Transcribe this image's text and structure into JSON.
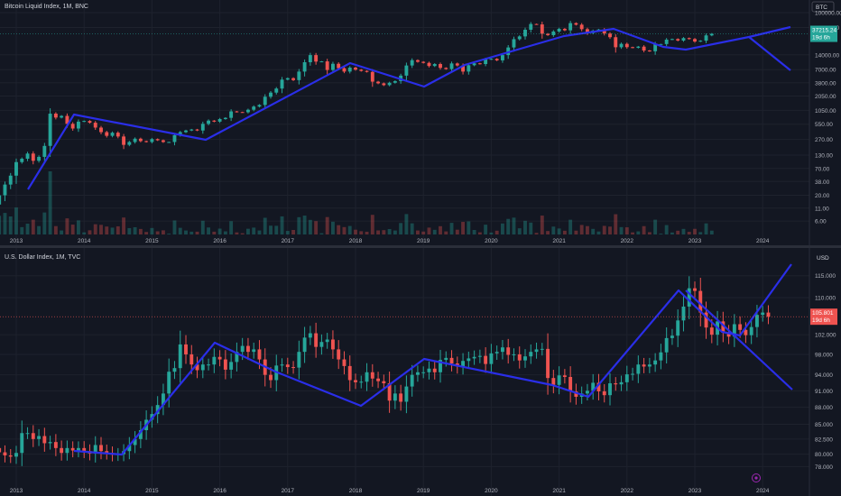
{
  "panes": [
    {
      "title": "Bitcoin Liquid Index, 1M, BNC",
      "currency": "BTC",
      "scale": "log",
      "y_ticks": [
        "100000.00",
        "50000.00",
        "14000.00",
        "7000.00",
        "3800.00",
        "2050.00",
        "1050.00",
        "550.00",
        "270.00",
        "130.00",
        "70.00",
        "38.00",
        "20.00",
        "11.00",
        "6.00"
      ],
      "y_range": [
        3.5,
        140000
      ],
      "last_price": "37215.24",
      "countdown": "19d 6h",
      "last_color": "#26a69a"
    },
    {
      "title": "U.S. Dollar Index, 1M, TVC",
      "currency": "USD",
      "scale": "log",
      "y_ticks": [
        "115.000",
        "110.000",
        "102.000",
        "98.000",
        "94.000",
        "91.000",
        "88.000",
        "85.000",
        "82.500",
        "80.000",
        "78.000"
      ],
      "y_range": [
        76.5,
        117.5
      ],
      "last_price": "105.801",
      "countdown": "19d 6h",
      "last_color": "#ef5350"
    }
  ],
  "x_axis": [
    "2013",
    "2014",
    "2015",
    "2016",
    "2017",
    "2018",
    "2019",
    "2020",
    "2021",
    "2022",
    "2023",
    "2024"
  ],
  "chart_data": [
    {
      "type": "candlestick",
      "title": "Bitcoin Liquid Index, 1M, BNC",
      "x_start": 2012.5,
      "y_scale": "log",
      "closes": [
        8,
        10,
        13,
        20,
        33,
        50,
        94,
        110,
        140,
        100,
        120,
        200,
        900,
        750,
        810,
        560,
        450,
        620,
        640,
        590,
        470,
        380,
        320,
        370,
        310,
        210,
        240,
        280,
        250,
        240,
        275,
        260,
        240,
        240,
        330,
        380,
        410,
        430,
        410,
        560,
        650,
        620,
        700,
        740,
        1000,
        970,
        960,
        1080,
        1250,
        1350,
        1980,
        2400,
        2900,
        4400,
        4700,
        4300,
        6400,
        9900,
        13800,
        10200,
        10300,
        6900,
        9200,
        7500,
        6400,
        7700,
        7000,
        6600,
        6300,
        4000,
        3700,
        3400,
        3800,
        4100,
        5300,
        8500,
        10900,
        10100,
        9600,
        8300,
        9100,
        7600,
        7200,
        9350,
        8500,
        6400,
        8600,
        9400,
        9100,
        11300,
        11600,
        10800,
        13800,
        19700,
        29000,
        33000,
        45000,
        58800,
        57700,
        37300,
        35000,
        41500,
        47000,
        43800,
        61300,
        57000,
        46200,
        38500,
        43200,
        45500,
        37700,
        31800,
        19900,
        23300,
        20000,
        19400,
        20500,
        17100,
        16500,
        23100,
        23100,
        28400,
        29200,
        27200,
        30500,
        29200,
        26000,
        27000,
        34600,
        37215
      ]
    },
    {
      "type": "candlestick",
      "title": "U.S. Dollar Index, 1M, TVC",
      "x_start": 2012.5,
      "y_scale": "log",
      "closes": [
        80.5,
        79.6,
        81.0,
        80.3,
        79.8,
        79.6,
        80.2,
        83.5,
        83.5,
        82.5,
        83.0,
        81.8,
        82.0,
        81.0,
        80.2,
        81.0,
        80.6,
        81.0,
        80.5,
        80.1,
        81.5,
        80.5,
        80.2,
        79.9,
        80.0,
        80.5,
        81.5,
        82.5,
        84.0,
        85.8,
        86.8,
        88.4,
        90.5,
        94.6,
        95.3,
        100.0,
        98.0,
        96.0,
        94.9,
        96.0,
        96.0,
        97.5,
        97.0,
        95.0,
        96.5,
        98.5,
        99.7,
        98.5,
        99.0,
        97.0,
        94.0,
        93.0,
        95.8,
        96.0,
        95.5,
        95.4,
        98.5,
        101.4,
        102.3,
        99.5,
        100.5,
        101.0,
        99.0,
        97.0,
        95.7,
        93.0,
        92.6,
        92.7,
        94.5,
        93.3,
        92.8,
        92.4,
        89.2,
        90.5,
        89.0,
        91.8,
        94.0,
        94.5,
        94.5,
        95.2,
        94.5,
        96.9,
        97.3,
        96.2,
        95.6,
        96.7,
        97.2,
        97.5,
        97.7,
        96.1,
        98.2,
        98.5,
        99.4,
        97.9,
        98.0,
        96.8,
        97.6,
        98.5,
        99.0,
        99.1,
        93.4,
        92.1,
        93.9,
        93.6,
        90.9,
        89.9,
        90.5,
        91.0,
        92.5,
        90.9,
        90.2,
        92.4,
        92.2,
        92.6,
        94.1,
        94.2,
        96.0,
        95.6,
        96.0,
        96.8,
        98.4,
        101.3,
        101.8,
        105.0,
        108.0,
        112.1,
        111.5,
        106.7,
        103.5,
        102.0,
        104.8,
        102.5,
        101.6,
        104.2,
        103.0,
        101.9,
        103.6,
        106.2,
        106.7,
        105.8
      ]
    }
  ]
}
